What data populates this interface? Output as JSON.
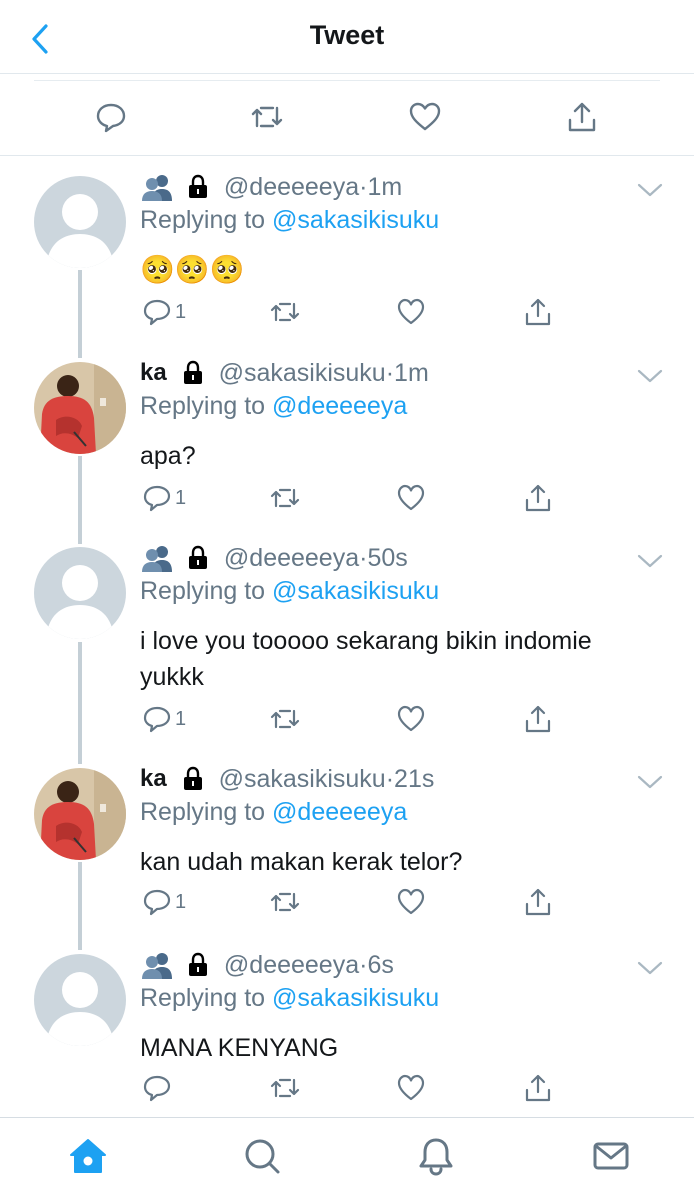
{
  "header": {
    "title": "Tweet",
    "back_icon": "chevron-left-icon"
  },
  "main_actions": [
    "reply-icon",
    "retweet-icon",
    "like-icon",
    "share-icon"
  ],
  "accent_color": "#1da1f2",
  "replies": [
    {
      "name": "",
      "icons": [
        "people-icon",
        "lock-icon"
      ],
      "handle": "@deeeeeya",
      "dot": "·",
      "time": "1m",
      "replying_label": "Replying to",
      "replying_to": "@sakasikisuku",
      "text": "🥺🥺🥺",
      "reply_count": "1"
    },
    {
      "name": "ka",
      "icons": [
        "lock-icon"
      ],
      "handle": "@sakasikisuku",
      "dot": "·",
      "time": "1m",
      "replying_label": "Replying to",
      "replying_to": "@deeeeeya",
      "text": "apa?",
      "reply_count": "1"
    },
    {
      "name": "",
      "icons": [
        "people-icon",
        "lock-icon"
      ],
      "handle": "@deeeeeya",
      "dot": "·",
      "time": "50s",
      "replying_label": "Replying to",
      "replying_to": "@sakasikisuku",
      "text": "i love you tooooo sekarang bikin indomie yukkk",
      "reply_count": "1"
    },
    {
      "name": "ka",
      "icons": [
        "lock-icon"
      ],
      "handle": "@sakasikisuku",
      "dot": "·",
      "time": "21s",
      "replying_label": "Replying to",
      "replying_to": "@deeeeeya",
      "text": "kan udah makan kerak telor?",
      "reply_count": "1"
    },
    {
      "name": "",
      "icons": [
        "people-icon",
        "lock-icon"
      ],
      "handle": "@deeeeeya",
      "dot": "·",
      "time": "6s",
      "replying_label": "Replying to",
      "replying_to": "@sakasikisuku",
      "text": "MANA KENYANG",
      "reply_count": ""
    }
  ],
  "tabbar": {
    "items": [
      "home-icon",
      "search-icon",
      "notifications-icon",
      "messages-icon"
    ],
    "active": "home-icon"
  }
}
